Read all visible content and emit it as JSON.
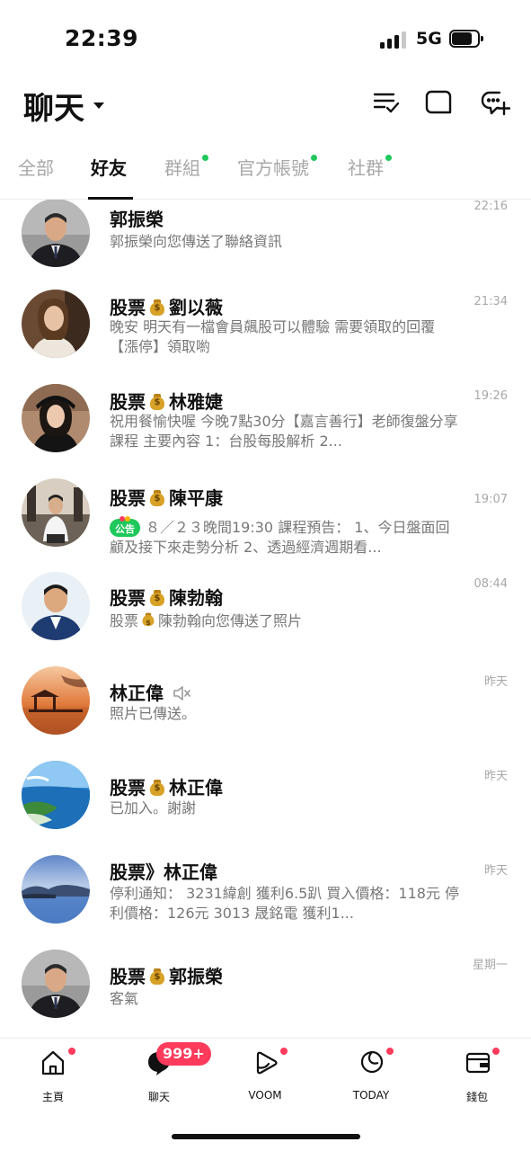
{
  "status_bar": {
    "time": "22:39",
    "network": "5G"
  },
  "header": {
    "title": "聊天"
  },
  "tabs": [
    {
      "label": "全部"
    },
    {
      "label": "好友"
    },
    {
      "label": "群組"
    },
    {
      "label": "官方帳號"
    },
    {
      "label": "社群"
    }
  ],
  "chats": [
    {
      "name": "郭振榮",
      "time": "22:16",
      "preview": "郭振榮向您傳送了聯絡資訊"
    },
    {
      "name_prefix": "股票",
      "name_suffix": "劉以薇",
      "time": "21:34",
      "preview": "晚安 明天有一檔會員飆股可以體驗 需要領取的回覆【漲停】領取喲"
    },
    {
      "name_prefix": "股票",
      "name_suffix": "林雅婕",
      "time": "19:26",
      "preview": "祝用餐愉快喔 今晚7點30分【嘉言善行】老師復盤分享課程 主要內容 1：台股每股解析 2..."
    },
    {
      "name_prefix": "股票",
      "name_suffix": "陳平康",
      "time": "19:07",
      "notice_label": "公告",
      "preview": "８／２３晚間19:30 課程預告： 1、今日盤面回顧及接下來走勢分析 2、透過經濟週期看..."
    },
    {
      "name_prefix": "股票",
      "name_suffix": "陳勃翰",
      "time": "08:44",
      "preview_prefix": "股票",
      "preview_suffix": "陳勃翰向您傳送了照片"
    },
    {
      "name": "林正偉",
      "time": "昨天",
      "preview": "照片已傳送。"
    },
    {
      "name_prefix": "股票",
      "name_suffix": "林正偉",
      "time": "昨天",
      "preview": "已加入。謝謝"
    },
    {
      "name": "股票》林正偉",
      "time": "昨天",
      "preview": "停利通知： 3231緯創 獲利6.5趴 買入價格：118元 停利價格：126元 3013 晟銘電 獲利1..."
    },
    {
      "name_prefix": "股票",
      "name_suffix": "郭振榮",
      "time": "星期一",
      "preview": "客氣"
    }
  ],
  "bottom_nav": {
    "items": [
      {
        "label": "主頁",
        "icon": "home-icon"
      },
      {
        "label": "聊天",
        "icon": "chat-icon"
      },
      {
        "label": "VOOM",
        "icon": "voom-icon"
      },
      {
        "label": "TODAY",
        "icon": "today-icon"
      },
      {
        "label": "錢包",
        "icon": "wallet-icon"
      }
    ],
    "chat_badge": "999+"
  },
  "colors": {
    "accent_green": "#1ec85a",
    "badge_red": "#ff3b5c",
    "text_gray": "#777777"
  }
}
